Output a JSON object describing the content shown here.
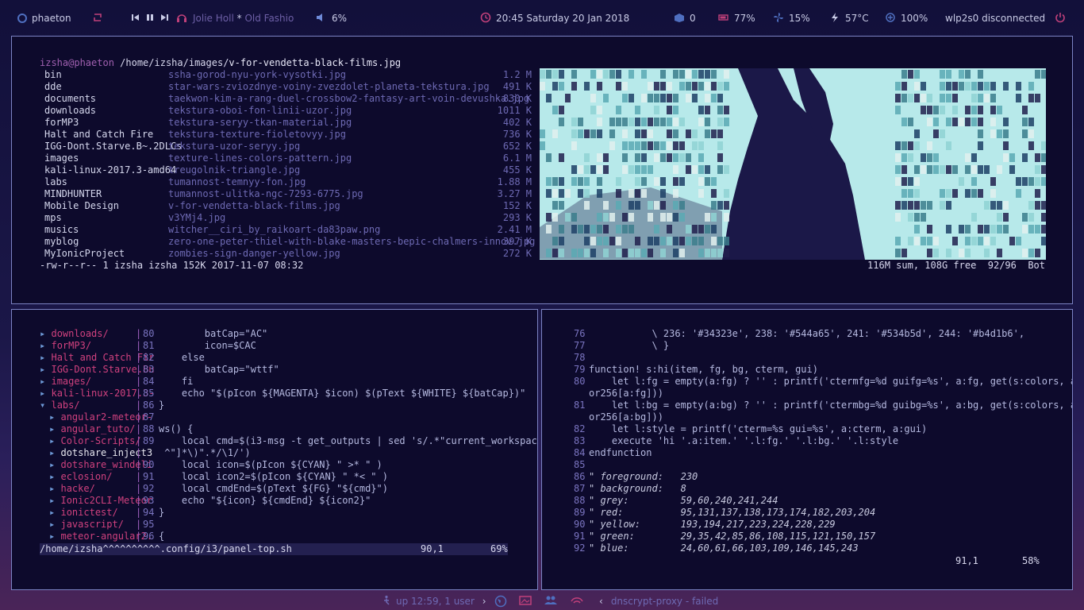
{
  "topbar": {
    "workspace": "phaeton",
    "player_artist": "Jolie Holl",
    "player_sep": "*",
    "player_title": "Old Fashio",
    "volume": "6%",
    "clock": "20:45  Saturday 20 Jan 2018",
    "updates": "0",
    "battery": "77%",
    "fan": "15%",
    "temp": "57°C",
    "brightness": "100%",
    "network": "wlp2s0 disconnected"
  },
  "ranger": {
    "path_user": "izsha@phaeton",
    "path_dir": " /home/izsha/images/",
    "path_file": "v-for-vendetta-black-films.jpg",
    "dirs": [
      "bin",
      "dde",
      "documents",
      "downloads",
      "forMP3",
      "Halt and Catch Fire",
      "IGG-Dont.Starve.B~.2DLCs",
      "images",
      "kali-linux-2017.3-amd64",
      "labs",
      "MINDHUNTER",
      "Mobile Design",
      "mps",
      "musics",
      "myblog",
      "MyIonicProject"
    ],
    "files": [
      {
        "name": "ssha-gorod-nyu-york-vysotki.jpg",
        "size": "1.2 M"
      },
      {
        "name": "star-wars-zviozdnye-voiny-zvezdolet-planeta-tekstura.jpg",
        "size": "491 K"
      },
      {
        "name": "taekwon-kim-a-rang-duel-crossbow2-fantasy-art-voin-devushka.jpg",
        "size": "830 K"
      },
      {
        "name": "tekstura-oboi-fon-linii-uzor.jpg",
        "size": "1011 K"
      },
      {
        "name": "tekstura-seryy-tkan-material.jpg",
        "size": "402 K"
      },
      {
        "name": "tekstura-texture-fioletovyy.jpg",
        "size": "736 K"
      },
      {
        "name": "tekstura-uzor-seryy.jpg",
        "size": "652 K"
      },
      {
        "name": "texture-lines-colors-pattern.jpg",
        "size": "6.1 M"
      },
      {
        "name": "treugolnik-triangle.jpg",
        "size": "455 K"
      },
      {
        "name": "tumannost-temnyy-fon.jpg",
        "size": "1.88 M"
      },
      {
        "name": "tumannost-ulitka-ngc-7293-6775.jpg",
        "size": "3.27 M"
      },
      {
        "name": "v-for-vendetta-black-films.jpg",
        "size": "152 K"
      },
      {
        "name": "v3YMj4.jpg",
        "size": "293 K"
      },
      {
        "name": "witcher__ciri_by_raikoart-da83paw.png",
        "size": "2.41 M"
      },
      {
        "name": "zero-one-peter-thiel-with-blake-masters-bepic-chalmers-innov.jpg",
        "size": "397 K"
      },
      {
        "name": "zombies-sign-danger-yellow.jpg",
        "size": "272 K"
      }
    ],
    "status_left": "-rw-r--r-- 1 izsha izsha 152K 2017-11-07 08:32",
    "status_right": "116M sum, 108G free  92/96  Bot"
  },
  "vim1": {
    "tree": [
      {
        "arrow": "▸",
        "name": "downloads/",
        "cls": "t-dir",
        "indent": 0
      },
      {
        "arrow": "▸",
        "name": "forMP3/",
        "cls": "t-dir",
        "indent": 0
      },
      {
        "arrow": "▸",
        "name": "Halt and Catch Fir",
        "cls": "t-dir",
        "indent": 0
      },
      {
        "arrow": "▸",
        "name": "IGG-Dont.Starve.Bu",
        "cls": "t-dir",
        "indent": 0
      },
      {
        "arrow": "▸",
        "name": "images/",
        "cls": "t-dir",
        "indent": 0
      },
      {
        "arrow": "▸",
        "name": "kali-linux-2017.3-",
        "cls": "t-dir",
        "indent": 0
      },
      {
        "arrow": "▾",
        "name": "labs/",
        "cls": "t-dir",
        "indent": 0
      },
      {
        "arrow": "▸",
        "name": "angular2-meteor-",
        "cls": "t-subdir",
        "indent": 1
      },
      {
        "arrow": "▸",
        "name": "angular_tuto/",
        "cls": "t-subdir",
        "indent": 1
      },
      {
        "arrow": "▸",
        "name": "Color-Scripts/",
        "cls": "t-subdir",
        "indent": 1
      },
      {
        "arrow": "▸",
        "name": "dotshare_inject3",
        "cls": "t-file",
        "indent": 1
      },
      {
        "arrow": "▸",
        "name": "dotshare_windeli",
        "cls": "t-subdir",
        "indent": 1
      },
      {
        "arrow": "▸",
        "name": "eclosion/",
        "cls": "t-subdir",
        "indent": 1
      },
      {
        "arrow": "▸",
        "name": "hacke/",
        "cls": "t-subdir",
        "indent": 1
      },
      {
        "arrow": "▸",
        "name": "Ionic2CLI-Meteor",
        "cls": "t-subdir",
        "indent": 1
      },
      {
        "arrow": "▸",
        "name": "ionictest/",
        "cls": "t-subdir",
        "indent": 1
      },
      {
        "arrow": "▸",
        "name": "javascript/",
        "cls": "t-subdir",
        "indent": 1
      },
      {
        "arrow": "▸",
        "name": "meteor-angular2.",
        "cls": "t-subdir",
        "indent": 1
      }
    ],
    "code": [
      {
        "n": "80",
        "text": "        batCap=\"AC\""
      },
      {
        "n": "81",
        "text": "        icon=$CAC"
      },
      {
        "n": "82",
        "text": "    else"
      },
      {
        "n": "83",
        "text": "        batCap=\"wttf\""
      },
      {
        "n": "84",
        "text": "    fi"
      },
      {
        "n": "85",
        "text": "    echo \"$(pIcon ${MAGENTA} $icon) $(pText ${WHITE} ${batCap})\""
      },
      {
        "n": "86",
        "text": "}"
      },
      {
        "n": "87",
        "text": ""
      },
      {
        "n": "88",
        "text": "ws() {"
      },
      {
        "n": "89",
        "text": "    local cmd=$(i3-msg -t get_outputs | sed 's/.*\"current_workspace\":\"\\(["
      },
      {
        "n": "",
        "text": " ^\"]*\\)\".*/\\1/')"
      },
      {
        "n": "90",
        "text": "    local icon=$(pIcon ${CYAN} \" >* \" )"
      },
      {
        "n": "91",
        "text": "    local icon2=$(pIcon ${CYAN} \" *< \" )"
      },
      {
        "n": "92",
        "text": "    local cmdEnd=$(pText ${FG} \"${cmd}\")"
      },
      {
        "n": "93",
        "text": "    echo \"${icon} ${cmdEnd} ${icon2}\""
      },
      {
        "n": "94",
        "text": "}"
      },
      {
        "n": "95",
        "text": ""
      },
      {
        "n": "96",
        "text": "{"
      }
    ],
    "status_file": "/home/izsha^^^^^^^^^^.config/i3/panel-top.sh",
    "status_pos": "90,1",
    "status_pct": "69%"
  },
  "vim2": {
    "code": [
      {
        "n": "76",
        "text": "           \\ 236: '#34323e', 238: '#544a65', 241: '#534b5d', 244: '#b4d1b6',"
      },
      {
        "n": "77",
        "text": "           \\ }"
      },
      {
        "n": "78",
        "text": ""
      },
      {
        "n": "79",
        "text": "function! s:hi(item, fg, bg, cterm, gui)"
      },
      {
        "n": "80",
        "text": "    let l:fg = empty(a:fg) ? '' : printf('ctermfg=%d guifg=%s', a:fg, get(s:colors, a:fg, s:col"
      },
      {
        "n": "",
        "text": "or256[a:fg]))"
      },
      {
        "n": "81",
        "text": "    let l:bg = empty(a:bg) ? '' : printf('ctermbg=%d guibg=%s', a:bg, get(s:colors, a:bg, s:col"
      },
      {
        "n": "",
        "text": "or256[a:bg]))"
      },
      {
        "n": "82",
        "text": "    let l:style = printf('cterm=%s gui=%s', a:cterm, a:gui)"
      },
      {
        "n": "83",
        "text": "    execute 'hi '.a:item.' '.l:fg.' '.l:bg.' '.l:style"
      },
      {
        "n": "84",
        "text": "endfunction"
      },
      {
        "n": "85",
        "text": ""
      },
      {
        "n": "86",
        "text": "\" foreground:   230"
      },
      {
        "n": "87",
        "text": "\" background:   8"
      },
      {
        "n": "88",
        "text": "\" grey:         59,60,240,241,244"
      },
      {
        "n": "89",
        "text": "\" red:          95,131,137,138,173,174,182,203,204"
      },
      {
        "n": "90",
        "text": "\" yellow:       193,194,217,223,224,228,229"
      },
      {
        "n": "91",
        "text": "\" green:        29,35,42,85,86,108,115,121,150,157"
      },
      {
        "n": "92",
        "text": "\" blue:         24,60,61,66,103,109,146,145,243"
      }
    ],
    "status_pos": "91,1",
    "status_pct": "58%"
  },
  "bottombar": {
    "uptime": "up 12:59, 1 user",
    "service": "dnscrypt-proxy - failed"
  }
}
